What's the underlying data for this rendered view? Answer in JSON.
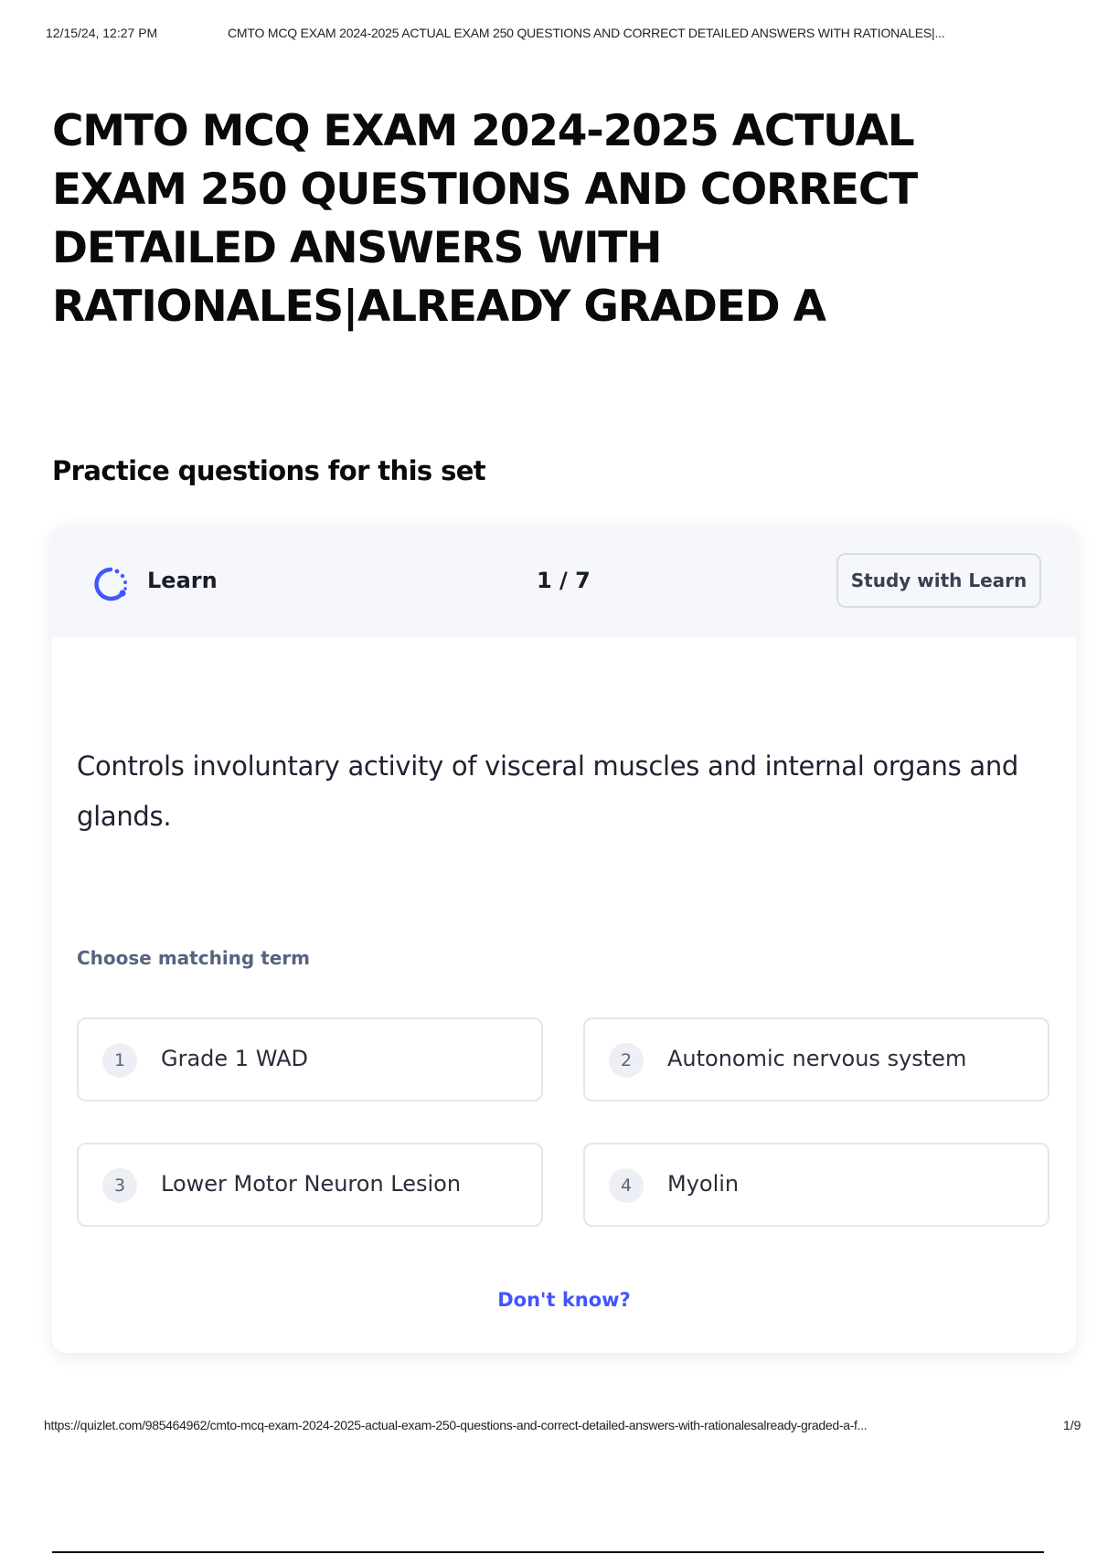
{
  "print_header": {
    "timestamp": "12/15/24, 12:27 PM",
    "document_title": "CMTO MCQ EXAM 2024-2025 ACTUAL EXAM 250 QUESTIONS AND CORRECT DETAILED ANSWERS WITH RATIONALES|..."
  },
  "page": {
    "title": "CMTO MCQ EXAM 2024-2025 ACTUAL EXAM 250 QUESTIONS AND CORRECT DETAILED ANSWERS WITH RATIONALES|ALREADY GRADED A",
    "section_heading": "Practice questions for this set"
  },
  "learn_card": {
    "mode_icon": "learn-progress-icon",
    "mode_label": "Learn",
    "progress": "1 / 7",
    "study_button_label": "Study with Learn",
    "prompt": "Controls involuntary activity of visceral muscles and internal organs and glands.",
    "choose_label": "Choose matching term",
    "options": [
      {
        "number": "1",
        "label": "Grade 1 WAD"
      },
      {
        "number": "2",
        "label": "Autonomic nervous system"
      },
      {
        "number": "3",
        "label": "Lower Motor Neuron Lesion"
      },
      {
        "number": "4",
        "label": "Myolin"
      }
    ],
    "dont_know_label": "Don't know?"
  },
  "print_footer": {
    "url": "https://quizlet.com/985464962/cmto-mcq-exam-2024-2025-actual-exam-250-questions-and-correct-detailed-answers-with-rationalesalready-graded-a-f...",
    "page_number": "1/9"
  },
  "colors": {
    "accent": "#4255ff",
    "header_bg": "#f6f7fb",
    "muted_text": "#586380"
  }
}
